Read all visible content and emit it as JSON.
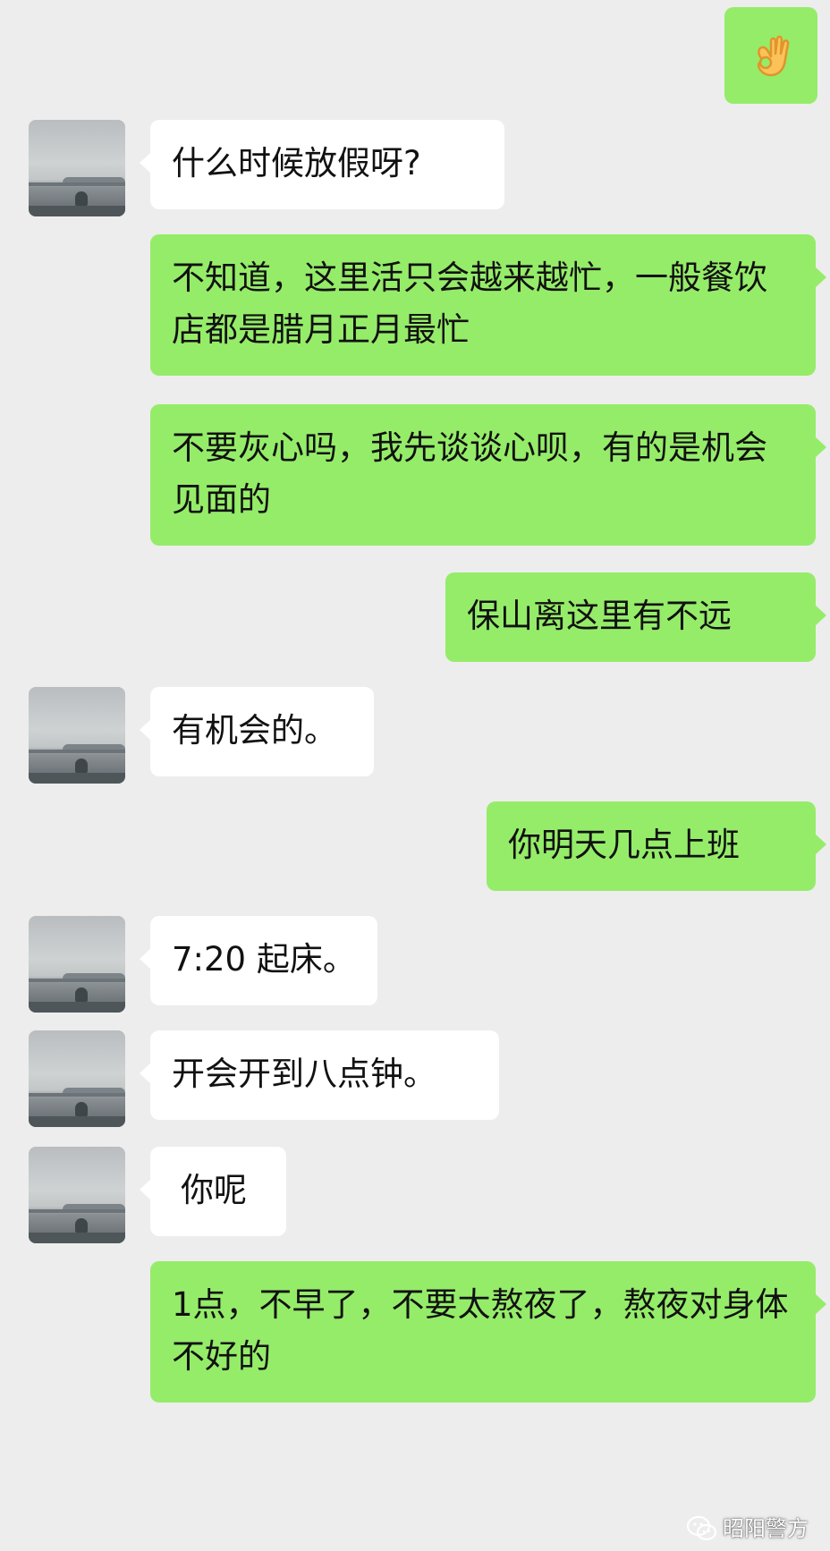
{
  "messages": [
    {
      "side": "out",
      "type": "emoji",
      "emoji": "ok-hand-icon"
    },
    {
      "side": "in",
      "text": "什么时候放假呀?"
    },
    {
      "side": "out",
      "text": "不知道，这里活只会越来越忙，一般餐饮店都是腊月正月最忙"
    },
    {
      "side": "out",
      "text": "不要灰心吗，我先谈谈心呗，有的是机会见面的"
    },
    {
      "side": "out",
      "text": "保山离这里有不远"
    },
    {
      "side": "in",
      "text": "有机会的。"
    },
    {
      "side": "out",
      "text": "你明天几点上班"
    },
    {
      "side": "in",
      "text": "7:20 起床。"
    },
    {
      "side": "in",
      "text": "开会开到八点钟。"
    },
    {
      "side": "in",
      "text": "你呢"
    },
    {
      "side": "out",
      "text": "1点，不早了，不要太熬夜了，熬夜对身体不好的"
    }
  ],
  "watermark": {
    "text": "昭阳警方",
    "icon": "wechat-icon"
  },
  "colors": {
    "background": "#ededed",
    "outgoing_bubble": "#95ec69",
    "incoming_bubble": "#ffffff"
  }
}
